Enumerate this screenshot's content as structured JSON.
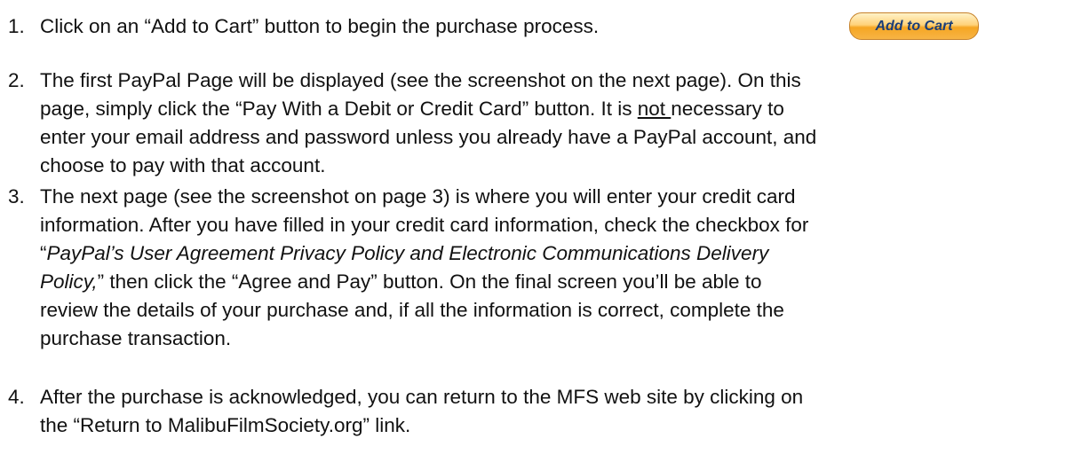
{
  "steps": [
    {
      "number": "1.",
      "text": "Click on an “Add to Cart” button to begin the purchase process."
    },
    {
      "number": "2.",
      "line1": "The first PayPal Page will be displayed (see the screenshot on the next page). On this",
      "line2a": "page, simply click the “Pay With a Debit or Credit Card” button. It is ",
      "line2b": "not ",
      "line2c": "necessary to",
      "line3": "enter your email address and password unless you already have a PayPal account, and",
      "line4": "choose to pay with that account."
    },
    {
      "number": "3.",
      "line1": "The next page (see the screenshot on page 3) is where you will enter your credit card",
      "line2": "information. After you have filled in your credit card information, check the checkbox for",
      "line3a": "“",
      "line3b": "PayPal’s User Agreement Privacy Policy and Electronic Communications Delivery",
      "line4a": "Policy,",
      "line4b": "” then click the “Agree and Pay” button. On the final screen you’ll be able to",
      "line5": "review the details of your purchase and, if all the information is correct, complete the",
      "line6": "purchase transaction."
    },
    {
      "number": "4.",
      "line1": "After the purchase is acknowledged, you can return to the MFS web site by clicking on",
      "line2": "the “Return to MalibuFilmSociety.org” link."
    }
  ],
  "add_to_cart_button": {
    "label": "Add to Cart"
  }
}
